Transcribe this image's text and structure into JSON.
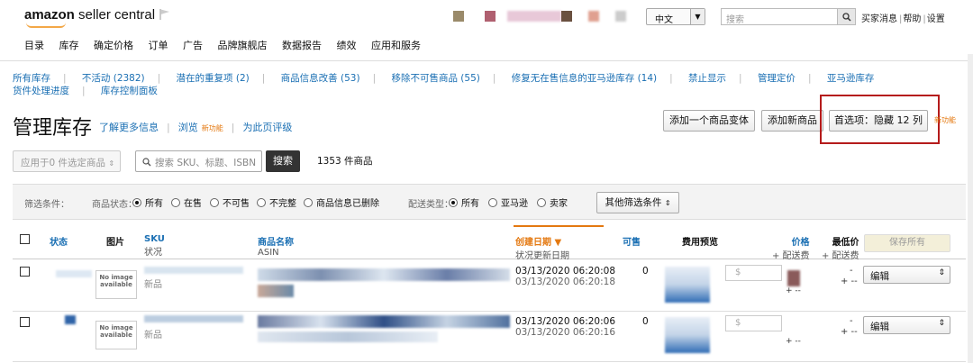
{
  "header": {
    "logo_brand": "amazon",
    "logo_suffix": " seller central",
    "language": "中文",
    "search_placeholder": "搜索",
    "links": [
      "买家消息",
      "帮助",
      "设置"
    ],
    "nav": [
      "目录",
      "库存",
      "确定价格",
      "订单",
      "广告",
      "品牌旗舰店",
      "数据报告",
      "绩效",
      "应用和服务"
    ]
  },
  "subnav": {
    "row1": [
      "所有库存",
      "不活动 (2382)",
      "潜在的重复项 (2)",
      "商品信息改善 (53)",
      "移除不可售商品 (55)",
      "修复无在售信息的亚马逊库存 (14)",
      "禁止显示",
      "管理定价",
      "亚马逊库存"
    ],
    "row2": [
      "货件处理进度",
      "库存控制面板"
    ]
  },
  "title": {
    "heading": "管理库存",
    "learn_more": "了解更多信息",
    "browse": "浏览",
    "new_tag": "新功能",
    "rate": "为此页评级"
  },
  "buttons": {
    "add_variation": "添加一个商品变体",
    "add_product": "添加新商品",
    "preferences": "首选项：隐藏 12 列"
  },
  "actions": {
    "apply_label": "应用于0 件选定商品",
    "search_placeholder": "搜索 SKU、标题、ISBN",
    "search_button": "搜索",
    "count": "1353 件商品"
  },
  "filters": {
    "filter_label": "筛选条件：",
    "status_label": "商品状态：",
    "status_options": [
      "所有",
      "在售",
      "不可售",
      "不完整",
      "商品信息已删除"
    ],
    "fulfill_label": "配送类型：",
    "fulfill_options": [
      "所有",
      "亚马逊",
      "卖家"
    ],
    "more": "其他筛选条件"
  },
  "table": {
    "headers": {
      "status": "状态",
      "image": "图片",
      "sku": "SKU",
      "sku_sub": "状况",
      "name": "商品名称",
      "name_sub": "ASIN",
      "created": "创建日期",
      "created_sub": "状况更新日期",
      "available": "可售",
      "fee": "费用预览",
      "price": "价格",
      "price_sub": "+ 配送费",
      "lowest": "最低价",
      "lowest_sub": "+ 配送费",
      "save_all": "保存所有"
    },
    "rows": [
      {
        "noimg": "No image available",
        "condition": "新品",
        "created": "03/13/2020 06:20:08",
        "updated": "03/13/2020 06:20:18",
        "available": "0",
        "price_prefix": "$",
        "ship": "+ --",
        "lowest": "-",
        "lowest_ship": "+ --",
        "action": "编辑"
      },
      {
        "noimg": "No image available",
        "condition": "新品",
        "created": "03/13/2020 06:20:06",
        "updated": "03/13/2020 06:20:16",
        "available": "0",
        "price_prefix": "$",
        "ship": "+ --",
        "lowest": "-",
        "lowest_ship": "+ --",
        "action": "编辑"
      }
    ]
  },
  "colors": {
    "link": "#1a6fb3",
    "accent": "#e47911",
    "highlight_border": "#b51b1b"
  }
}
